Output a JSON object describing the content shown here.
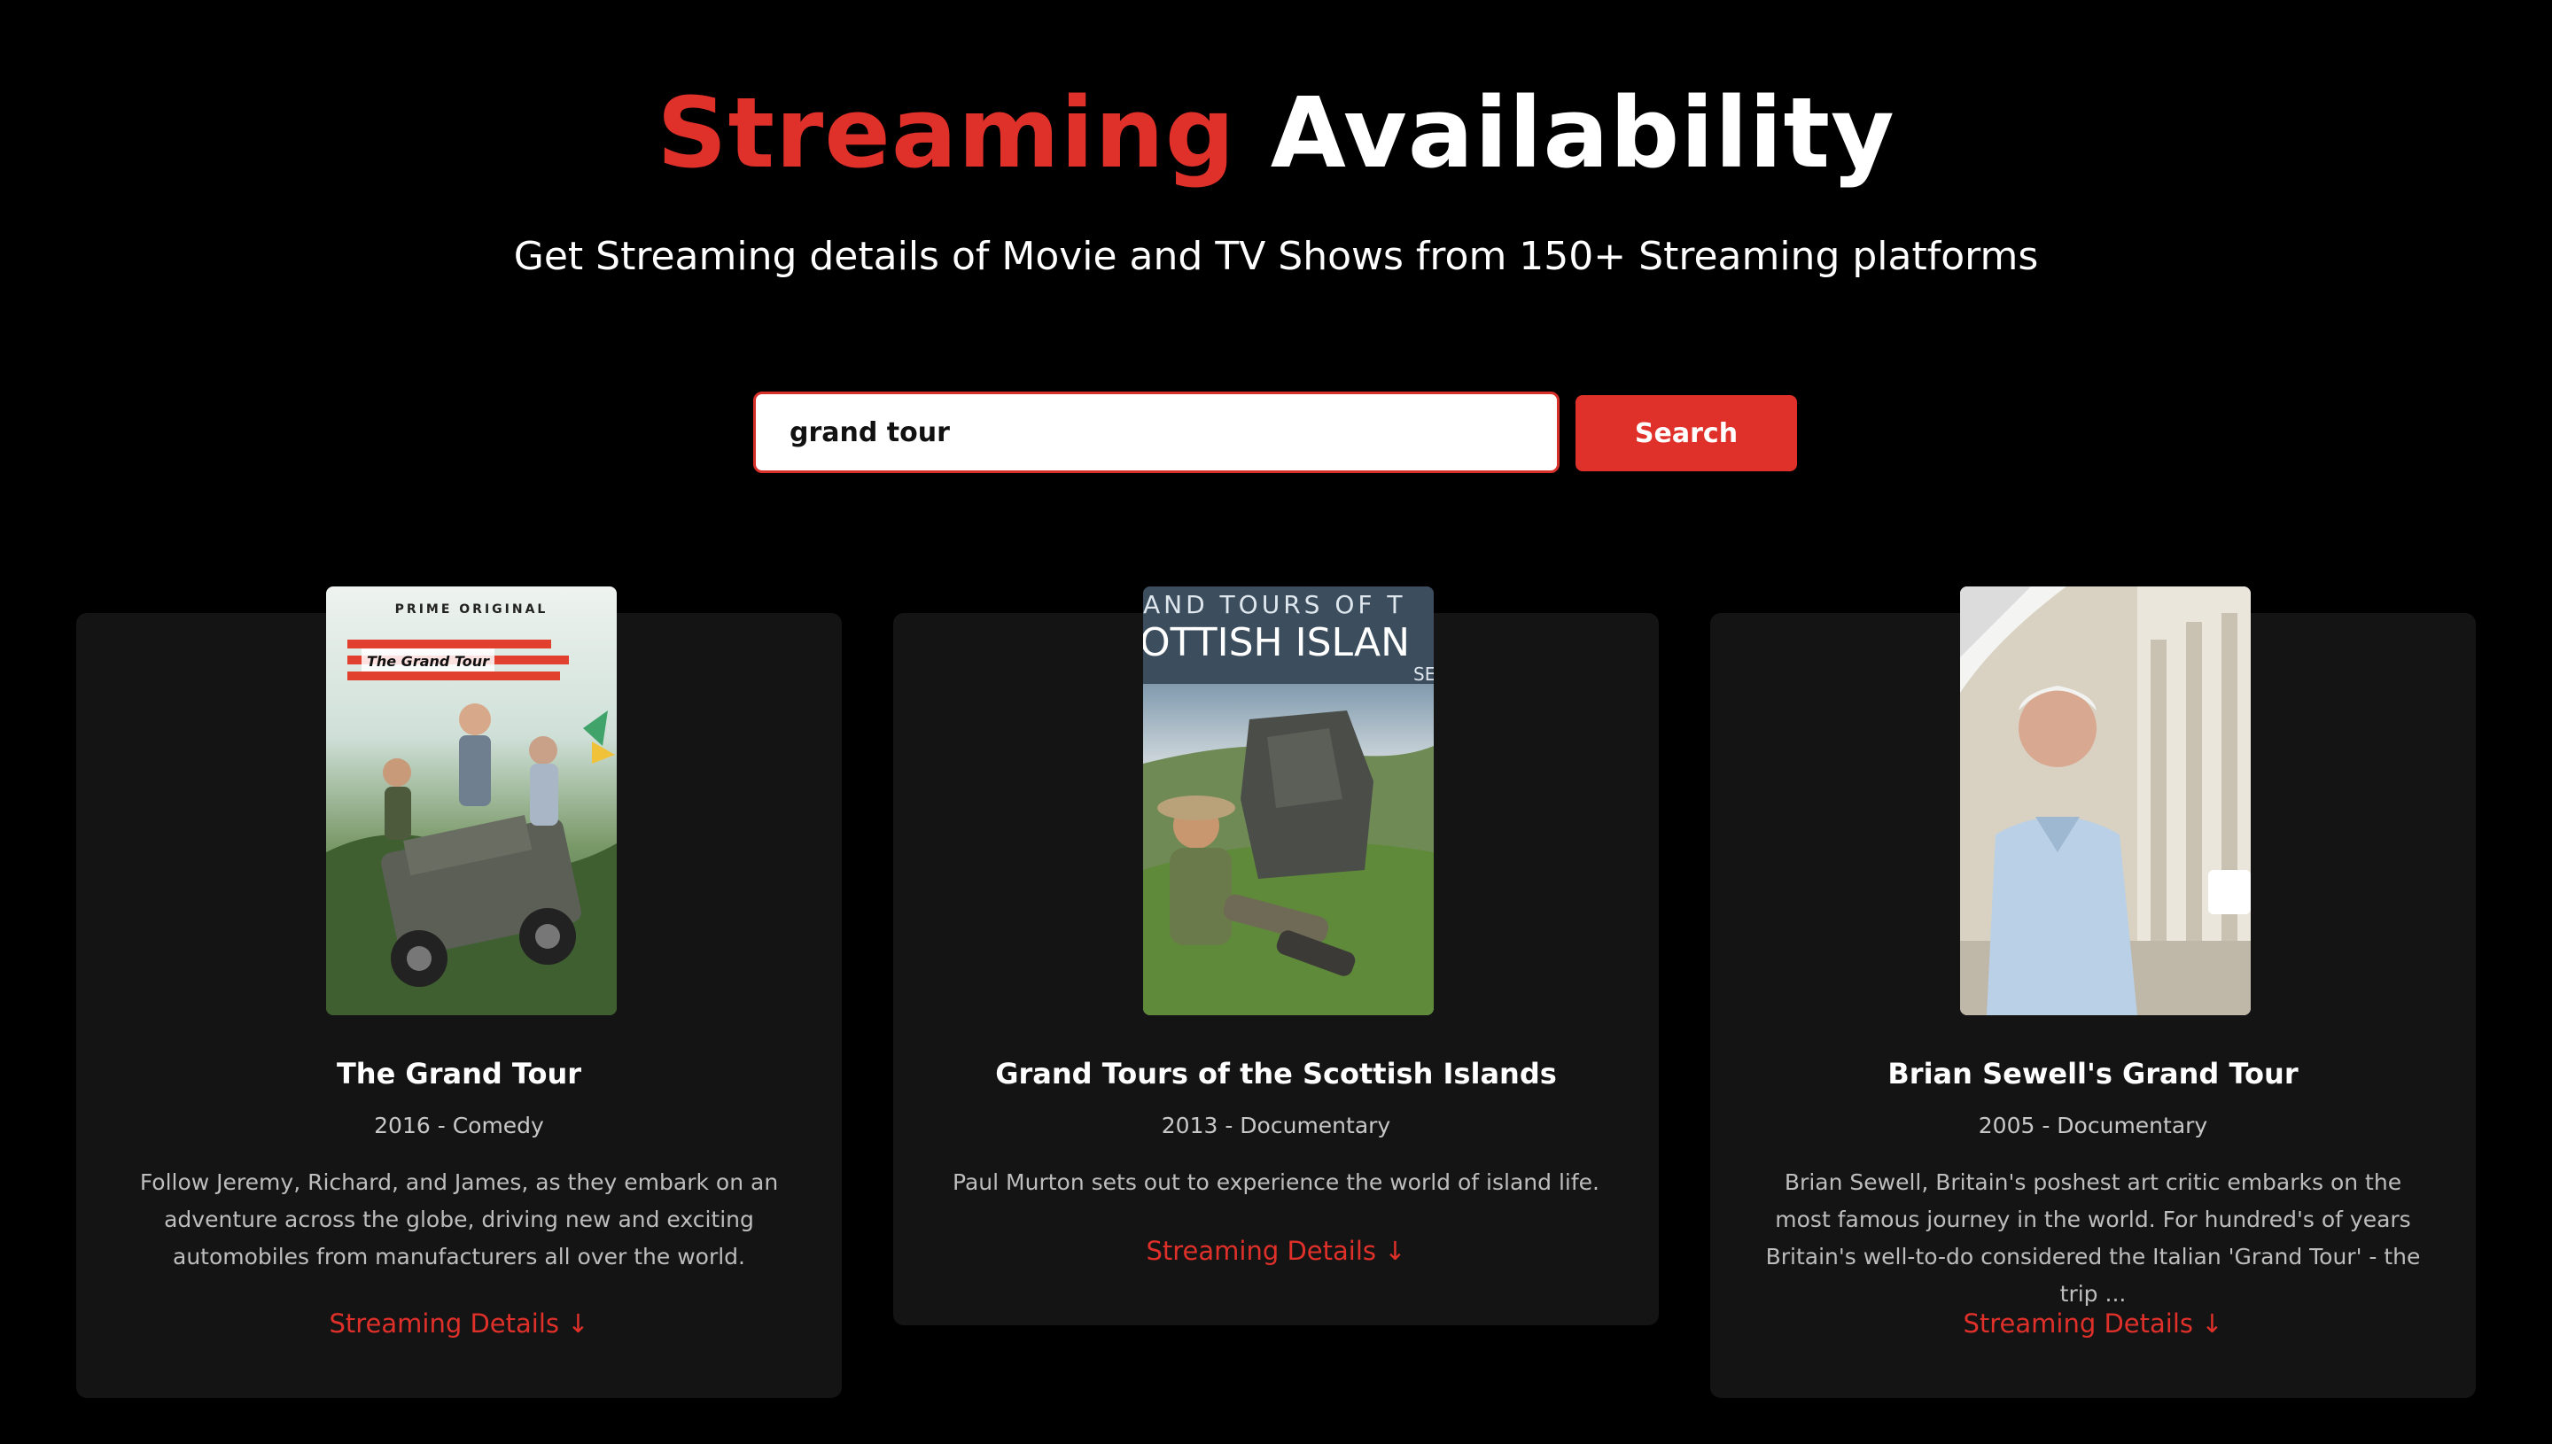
{
  "header": {
    "title_accent": "Streaming",
    "title_rest": " Availability",
    "subtitle": "Get Streaming details of Movie and TV Shows from 150+ Streaming platforms"
  },
  "search": {
    "value": "grand tour",
    "button_label": "Search"
  },
  "results": [
    {
      "poster_top_text": "PRIME ORIGINAL",
      "poster_logo_text": "The Grand Tour",
      "title": "The Grand Tour",
      "meta": "2016 - Comedy",
      "description": "Follow Jeremy, Richard, and James, as they embark on an adventure across the globe, driving new and exciting automobiles from manufacturers all over the world.",
      "link_label": "Streaming Details ↓"
    },
    {
      "poster_line1": "AND TOURS OF T",
      "poster_line2": "OTTISH ISLAN",
      "poster_line3": "SE",
      "title": "Grand Tours of the Scottish Islands",
      "meta": "2013 - Documentary",
      "description": "Paul Murton sets out to experience the world of island life.",
      "link_label": "Streaming Details ↓"
    },
    {
      "title": "Brian Sewell's Grand Tour",
      "meta": "2005 - Documentary",
      "description": "Brian Sewell, Britain's poshest art critic embarks on the most famous journey in the world. For hundred's of years Britain's well-to-do considered the Italian 'Grand Tour' - the trip ...",
      "link_label": "Streaming Details ↓"
    }
  ],
  "colors": {
    "background": "#000000",
    "accent": "#e0302a",
    "card": "#141414"
  }
}
